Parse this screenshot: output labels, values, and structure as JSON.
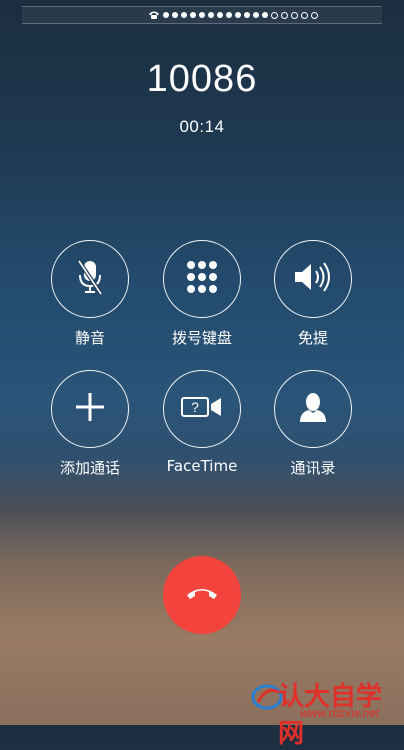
{
  "status_bar": {
    "signal_filled": 12,
    "signal_empty": 5,
    "icon": "phone-handset-icon"
  },
  "call": {
    "number": "10086",
    "duration": "00:14"
  },
  "controls": [
    {
      "label": "静音",
      "icon": "mute-mic-icon"
    },
    {
      "label": "拨号键盘",
      "icon": "keypad-icon"
    },
    {
      "label": "免提",
      "icon": "speaker-icon"
    },
    {
      "label": "添加通话",
      "icon": "plus-icon"
    },
    {
      "label": "FaceTime",
      "icon": "facetime-icon"
    },
    {
      "label": "通讯录",
      "icon": "contacts-icon"
    }
  ],
  "end_call": {
    "icon": "end-call-icon",
    "color": "#f2433d"
  },
  "watermark": {
    "text": "认大自学网",
    "url": "www.rdzxw.net"
  }
}
